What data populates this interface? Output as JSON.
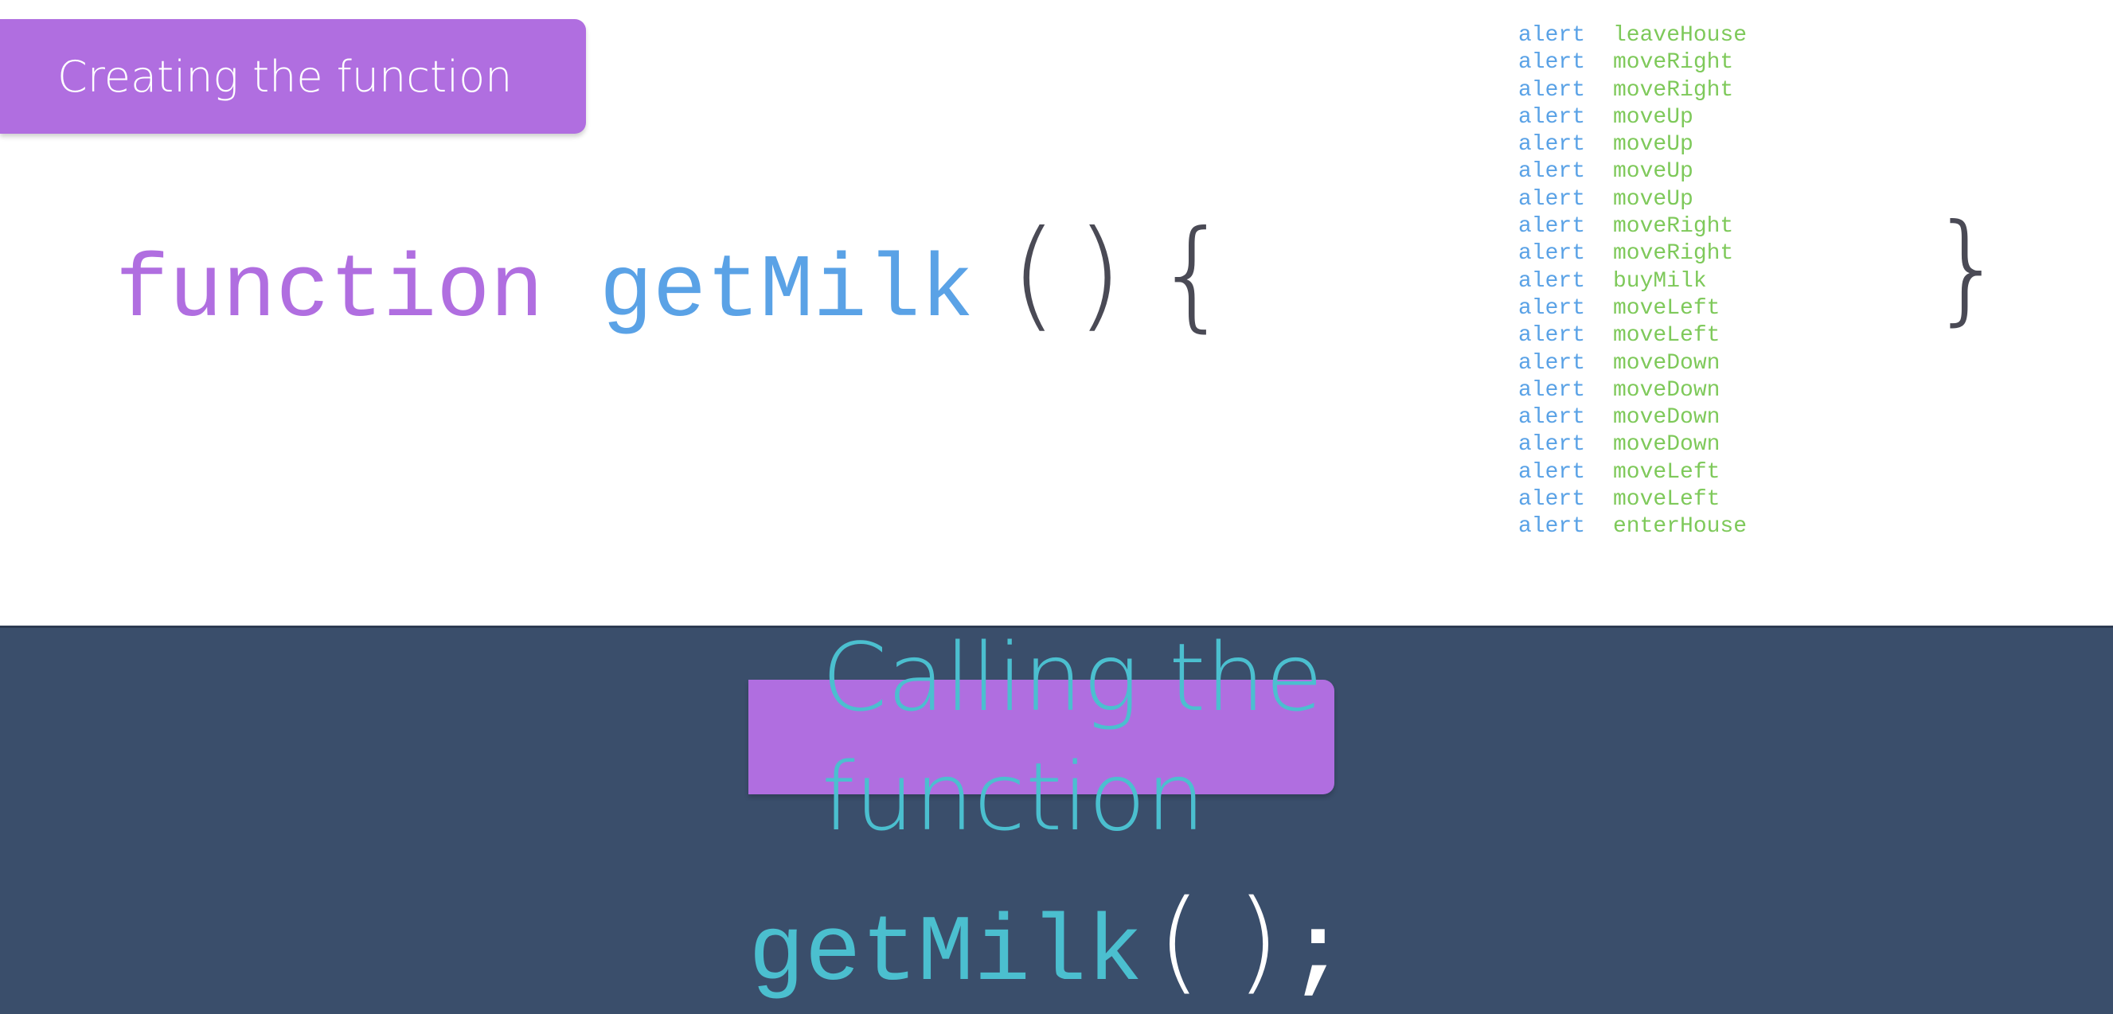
{
  "sections": {
    "create_label": "Creating the function",
    "call_label": "Calling the function"
  },
  "declaration": {
    "keyword": "function",
    "name": "getMilk",
    "paren_open": "(",
    "paren_close": ")",
    "brace_open": "{",
    "brace_close": "}"
  },
  "body": {
    "alert_keyword": "alert",
    "commands": [
      "leaveHouse",
      "moveRight",
      "moveRight",
      "moveUp",
      "moveUp",
      "moveUp",
      "moveUp",
      "moveRight",
      "moveRight",
      "buyMilk",
      "moveLeft",
      "moveLeft",
      "moveDown",
      "moveDown",
      "moveDown",
      "moveDown",
      "moveLeft",
      "moveLeft",
      "enterHouse"
    ]
  },
  "call": {
    "name": "getMilk",
    "parens": "( )",
    "semicolon": ";"
  },
  "colors": {
    "keyword": "#b06ee0",
    "function_name": "#5aa2e6",
    "command": "#7ec95a",
    "call_name": "#4bbfcf",
    "banner": "#b06ee0",
    "dark_panel": "#3a4e6b"
  }
}
